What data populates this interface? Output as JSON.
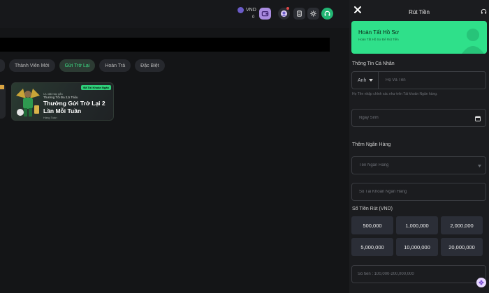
{
  "header": {
    "currency": "VND",
    "balance": "0"
  },
  "tabs": [
    {
      "label": ""
    },
    {
      "label": "Thành Viên Mới"
    },
    {
      "label": "Gửi Trở Lại",
      "active": true
    },
    {
      "label": "Hoàn Trả"
    },
    {
      "label": "Đặc Biệt"
    }
  ],
  "promo": {
    "badge": "Đã Tài Khoản Ngân",
    "sub": "Ưu đãi hấp dẫn",
    "line2": "Thưởng Tối Đa 2,5 Triệu",
    "title": "Thưởng Gửi Trở Lại 2 Lần Mỗi Tuần",
    "small": "Hàng Tuần"
  },
  "panel": {
    "title": "Rút Tiền",
    "profile": {
      "title": "Hoàn Tất Hồ Sơ",
      "subtitle": "Hoàn Tất Hồ Sơ Để Rút Tiền"
    },
    "personal_label": "Thông Tin Cá Nhân",
    "salutation": "Anh",
    "name_placeholder": "Họ Và Tên",
    "name_hint": "Họ Tên nhập chính xác như trên Tài khoản Ngân hàng.",
    "dob_placeholder": "Ngày Sinh",
    "bank_section": "Thêm Ngân Hàng",
    "bank_placeholder": "Tên Ngân Hàng",
    "account_placeholder": "Số Tài Khoản Ngân Hàng",
    "amount_label": "Số Tiền Rút (VND)",
    "amounts": [
      "500,000",
      "1,000,000",
      "2,000,000",
      "5,000,000",
      "10,000,000",
      "20,000,000"
    ],
    "money_placeholder": "Số tiền : 100,000-200,000,000"
  },
  "colors": {
    "accent": "#2fe08a",
    "panel_bg": "#1b1c1f",
    "amount_btn": "#2b2e37"
  }
}
